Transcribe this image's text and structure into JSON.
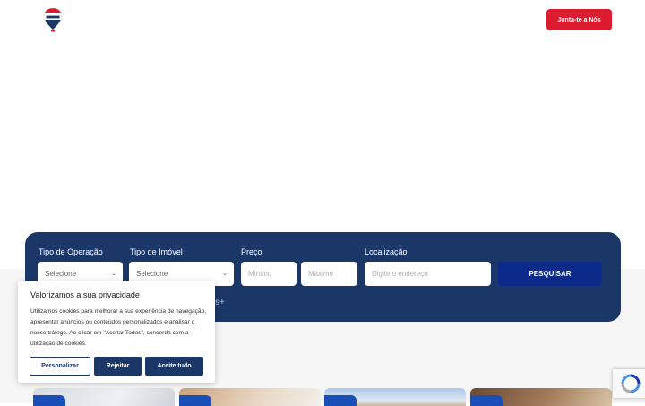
{
  "header": {
    "logo_icon": "remax-balloon-logo-icon",
    "join_button_label": "Junta-te a Nós"
  },
  "search": {
    "operation_label": "Tipo de Operação",
    "operation_value": "Selecione",
    "property_type_label": "Tipo de Imóvel",
    "property_type_value": "Selecione",
    "price_label": "Preço",
    "price_min_placeholder": "Mínimo",
    "price_max_placeholder": "Máximo",
    "location_label": "Localização",
    "location_placeholder": "Digite o endereço",
    "search_button_label": "PESQUISAR",
    "more_filters_label": "s+"
  },
  "cookie_banner": {
    "title": "Valorizamos a sua privacidade",
    "text": "Utilizamos cookies para melhorar a sua experiência de navegação, apresentar anúncios ou conteúdos personalizados e analisar o nosso tráfego. Ao clicar em \"Aceitar Todos\", concorda com a utilização de cookies.",
    "customize_label": "Personalizar",
    "reject_label": "Rejeitar",
    "accept_label": "Aceite tudo"
  },
  "recaptcha": {
    "icon": "recaptcha-icon"
  },
  "colors": {
    "brand_red": "#dc1c2e",
    "brand_navy": "#1b3768",
    "search_blue": "#0b2a8a",
    "badge_blue": "#1b4fb8"
  }
}
